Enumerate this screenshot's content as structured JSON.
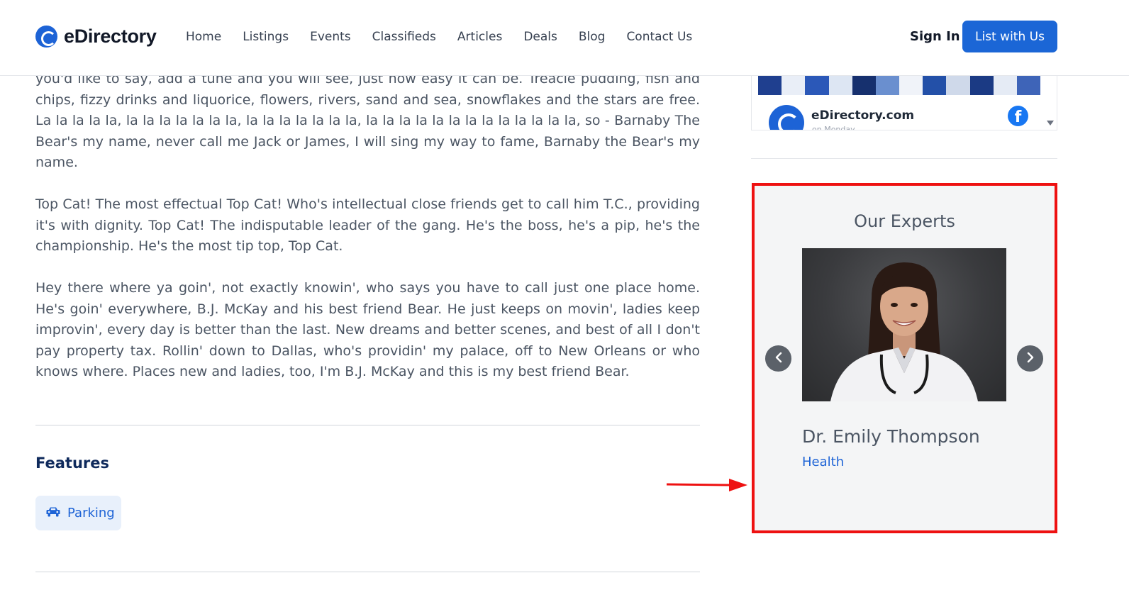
{
  "header": {
    "logo_text": "eDirectory",
    "nav": [
      "Home",
      "Listings",
      "Events",
      "Classifieds",
      "Articles",
      "Deals",
      "Blog",
      "Contact Us"
    ],
    "sign_in": "Sign In",
    "list_with_us": "List with Us"
  },
  "facebook_widget": {
    "page_name": "eDirectory.com",
    "subtitle": "on Monday",
    "icon": "facebook-icon"
  },
  "content": {
    "paragraphs": [
      "you'd like to say, add a tune and you will see, just how easy it can be. Treacle pudding, fish and chips, fizzy drinks and liquorice, flowers, rivers, sand and sea, snowflakes and the stars are free. La la la la la, la la la la la la la, la la la la la la la, la la la la la la la la la la la la la, so - Barnaby The Bear's my name, never call me Jack or James, I will sing my way to fame, Barnaby the Bear's my name.",
      "Top Cat! The most effectual Top Cat! Who's intellectual close friends get to call him T.C., providing it's with dignity. Top Cat! The indisputable leader of the gang. He's the boss, he's a pip, he's the championship. He's the most tip top, Top Cat.",
      "Hey there where ya goin', not exactly knowin', who says you have to call just one place home. He's goin' everywhere, B.J. McKay and his best friend Bear. He just keeps on movin', ladies keep improvin', every day is better than the last. New dreams and better scenes, and best of all I don't pay property tax. Rollin' down to Dallas, who's providin' my palace, off to New Orleans or who knows where. Places new and ladies, too, I'm B.J. McKay and this is my best friend Bear."
    ],
    "features_title": "Features",
    "features": [
      {
        "label": "Parking",
        "icon": "car-icon"
      }
    ]
  },
  "experts": {
    "title": "Our Experts",
    "name": "Dr. Emily Thompson",
    "category": "Health",
    "prev_icon": "chevron-left-icon",
    "next_icon": "chevron-right-icon"
  },
  "colors": {
    "brand_blue": "#1b66d6",
    "highlight_red": "#ee1111",
    "heading_navy": "#0f2a5c"
  }
}
